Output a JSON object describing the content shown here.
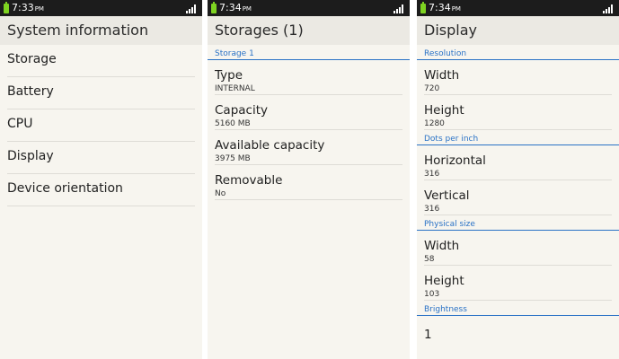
{
  "screens": [
    {
      "time": "7:33",
      "ampm": "PM",
      "title": "System information",
      "items": [
        "Storage",
        "Battery",
        "CPU",
        "Display",
        "Device orientation"
      ]
    },
    {
      "time": "7:34",
      "ampm": "PM",
      "title": "Storages (1)",
      "sections": [
        {
          "header": "Storage 1",
          "rows": [
            {
              "label": "Type",
              "value": "INTERNAL"
            },
            {
              "label": "Capacity",
              "value": "5160 MB"
            },
            {
              "label": "Available capacity",
              "value": "3975 MB"
            },
            {
              "label": "Removable",
              "value": "No"
            }
          ]
        }
      ]
    },
    {
      "time": "7:34",
      "ampm": "PM",
      "title": "Display",
      "sections": [
        {
          "header": "Resolution",
          "rows": [
            {
              "label": "Width",
              "value": "720"
            },
            {
              "label": "Height",
              "value": "1280"
            }
          ]
        },
        {
          "header": "Dots per inch",
          "rows": [
            {
              "label": "Horizontal",
              "value": "316"
            },
            {
              "label": "Vertical",
              "value": "316"
            }
          ]
        },
        {
          "header": "Physical size",
          "rows": [
            {
              "label": "Width",
              "value": "58"
            },
            {
              "label": "Height",
              "value": "103"
            }
          ]
        },
        {
          "header": "Brightness",
          "rows": [
            {
              "label": "1",
              "value": ""
            }
          ]
        }
      ]
    }
  ],
  "colors": {
    "statusbar": "#1c1c1c",
    "titlebar": "#ebe9e3",
    "background": "#f7f5ef",
    "accent": "#2a72c6",
    "battery": "#7ed321"
  },
  "icons": [
    "battery-icon",
    "signal-icon"
  ]
}
